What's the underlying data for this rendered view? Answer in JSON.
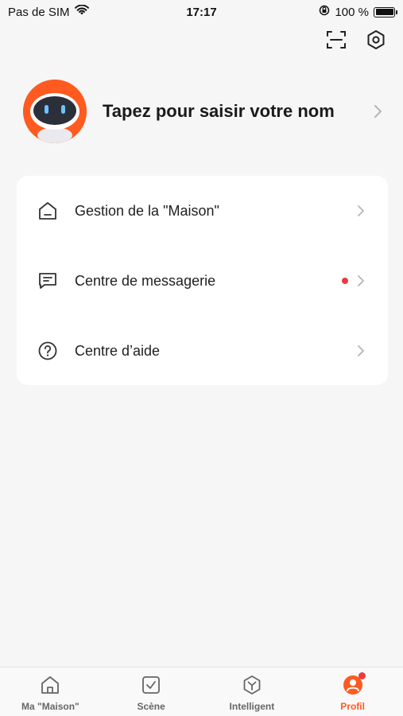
{
  "status_bar": {
    "carrier": "Pas de SIM",
    "time": "17:17",
    "battery_text": "100 %",
    "icons": [
      "wifi-icon",
      "orientation-lock-icon",
      "battery-icon"
    ]
  },
  "top_actions": {
    "icons": [
      "scan-icon",
      "settings-icon"
    ]
  },
  "profile": {
    "name_prompt": "Tapez pour saisir votre nom",
    "avatar_icon": "robot-avatar-icon"
  },
  "menu": {
    "items": [
      {
        "label": "Gestion de la \"Maison\"",
        "icon": "home-icon",
        "has_dot": false
      },
      {
        "label": "Centre de messagerie",
        "icon": "message-icon",
        "has_dot": true
      },
      {
        "label": "Centre d’aide",
        "icon": "help-icon",
        "has_dot": false
      }
    ]
  },
  "tabs": {
    "items": [
      {
        "label": "Ma \"Maison\"",
        "icon": "home-tab-icon",
        "active": false
      },
      {
        "label": "Scène",
        "icon": "scene-tab-icon",
        "active": false
      },
      {
        "label": "Intelligent",
        "icon": "intelligent-tab-icon",
        "active": false
      },
      {
        "label": "Profil",
        "icon": "profile-tab-icon",
        "active": true,
        "badge": true
      }
    ]
  },
  "colors": {
    "accent": "#ff5a1f",
    "badge": "#ea3b3b",
    "background": "#f6f6f6",
    "card": "#ffffff"
  }
}
